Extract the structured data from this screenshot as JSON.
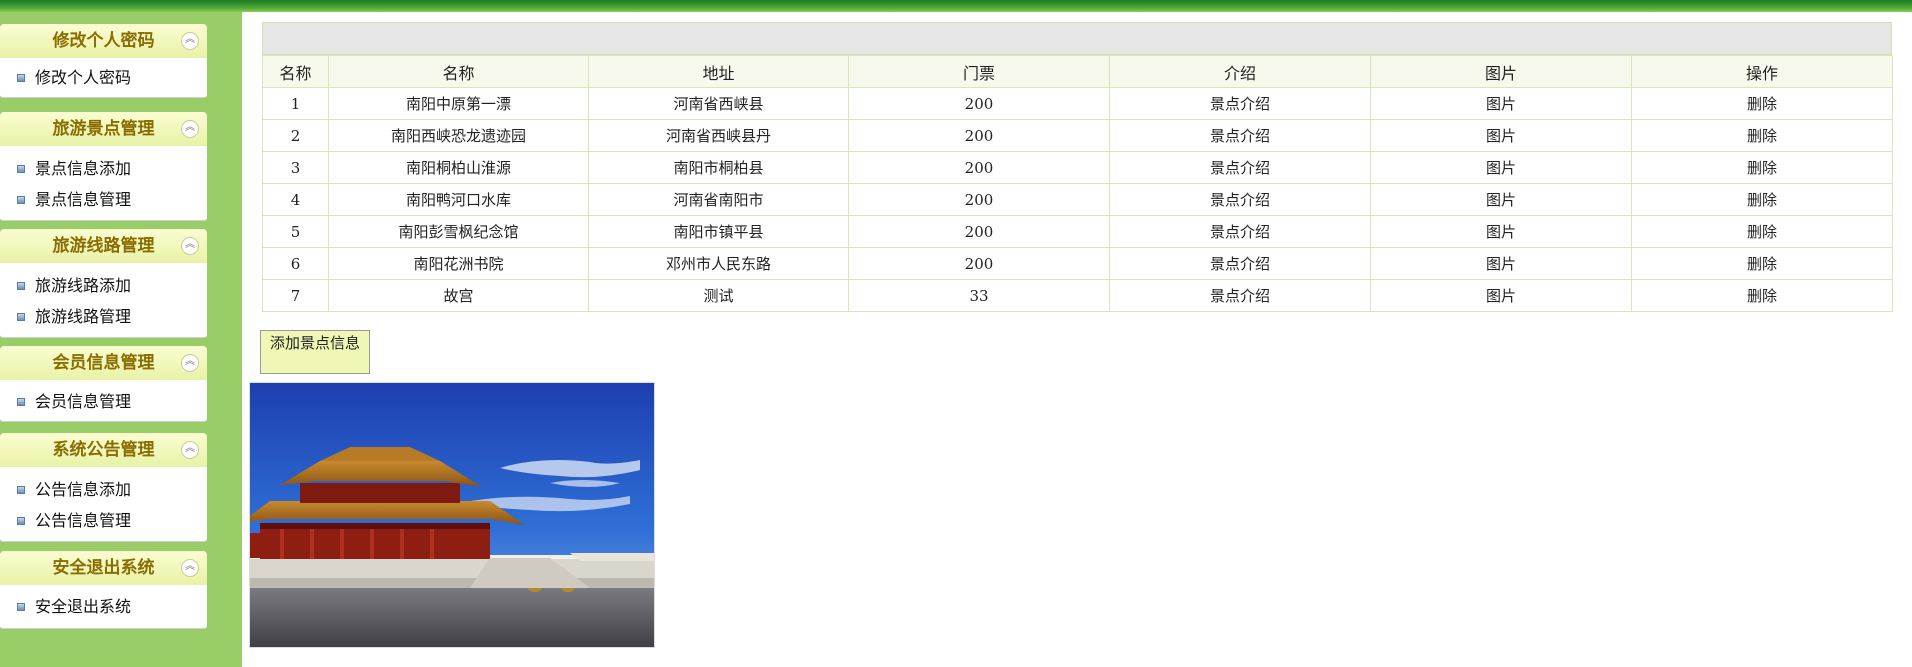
{
  "sidebar": {
    "groups": [
      {
        "title": "修改个人密码",
        "items": [
          "修改个人密码"
        ]
      },
      {
        "title": "旅游景点管理",
        "items": [
          "景点信息添加",
          "景点信息管理"
        ]
      },
      {
        "title": "旅游线路管理",
        "items": [
          "旅游线路添加",
          "旅游线路管理"
        ]
      },
      {
        "title": "会员信息管理",
        "items": [
          "会员信息管理"
        ]
      },
      {
        "title": "系统公告管理",
        "items": [
          "公告信息添加",
          "公告信息管理"
        ]
      },
      {
        "title": "安全退出系统",
        "items": [
          "安全退出系统"
        ]
      }
    ],
    "collapse_icon": "double-chevron-up-icon",
    "bullet_icon": "square-bullet-icon"
  },
  "table": {
    "headers": [
      "名称",
      "名称",
      "地址",
      "门票",
      "介绍",
      "图片",
      "操作"
    ],
    "rows": [
      [
        "1",
        "南阳中原第一漂",
        "河南省西峡县",
        "200",
        "景点介绍",
        "图片",
        "删除"
      ],
      [
        "2",
        "南阳西峡恐龙遗迹园",
        "河南省西峡县丹",
        "200",
        "景点介绍",
        "图片",
        "删除"
      ],
      [
        "3",
        "南阳桐柏山淮源",
        "南阳市桐柏县",
        "200",
        "景点介绍",
        "图片",
        "删除"
      ],
      [
        "4",
        "南阳鸭河口水库",
        "河南省南阳市",
        "200",
        "景点介绍",
        "图片",
        "删除"
      ],
      [
        "5",
        "南阳彭雪枫纪念馆",
        "南阳市镇平县",
        "200",
        "景点介绍",
        "图片",
        "删除"
      ],
      [
        "6",
        "南阳花洲书院",
        "邓州市人民东路",
        "200",
        "景点介绍",
        "图片",
        "删除"
      ],
      [
        "7",
        "故宫",
        "测试",
        "33",
        "景点介绍",
        "图片",
        "删除"
      ]
    ]
  },
  "add_button": {
    "label": "添加景点信息"
  },
  "colors": {
    "sidebar_bg": "#98cd67",
    "menu_title": "#8a6d00",
    "table_border": "#d8e6bb",
    "button_bg": "#f0f7b5"
  }
}
